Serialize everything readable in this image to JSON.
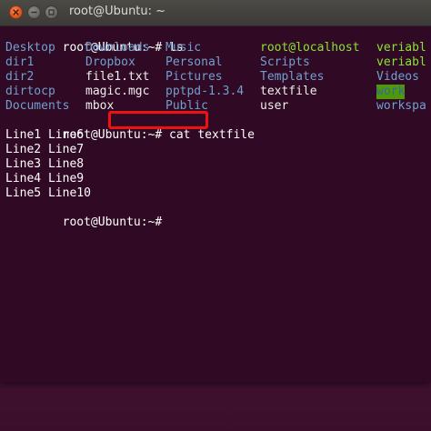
{
  "window": {
    "title": "root@Ubuntu: ~"
  },
  "colors": {
    "terminal_bg": "#300a24",
    "directory": "#729fcf",
    "executable": "#8ae234",
    "plain": "#eeeeec",
    "highlight_box": "#ee1111"
  },
  "terminal": {
    "prompt1": "root@Ubuntu:~# ",
    "cmd1": "ls",
    "ls": {
      "col1": [
        "Desktop",
        "dir1",
        "dir2",
        "dirtocp",
        "Documents"
      ],
      "col2": [
        "Downloads",
        "Dropbox",
        "file1.txt",
        "magic.mgc",
        "mbox"
      ],
      "col3": [
        "Music",
        "Personal",
        "Pictures",
        "pptpd-1.3.4",
        "Public"
      ],
      "col4": [
        "root@localhost",
        "Scripts",
        "Templates",
        "textfile",
        "user"
      ],
      "col5": [
        "veriable",
        "veriable",
        "Videos",
        "work",
        "workspac"
      ]
    },
    "prompt2": "root@Ubuntu:~# ",
    "cmd2": "cat textfile",
    "output": [
      "Line1 Line6",
      "Line2 Line7",
      "Line3 Line8",
      "Line4 Line9",
      "Line5 Line10"
    ],
    "prompt3": "root@Ubuntu:~# "
  }
}
